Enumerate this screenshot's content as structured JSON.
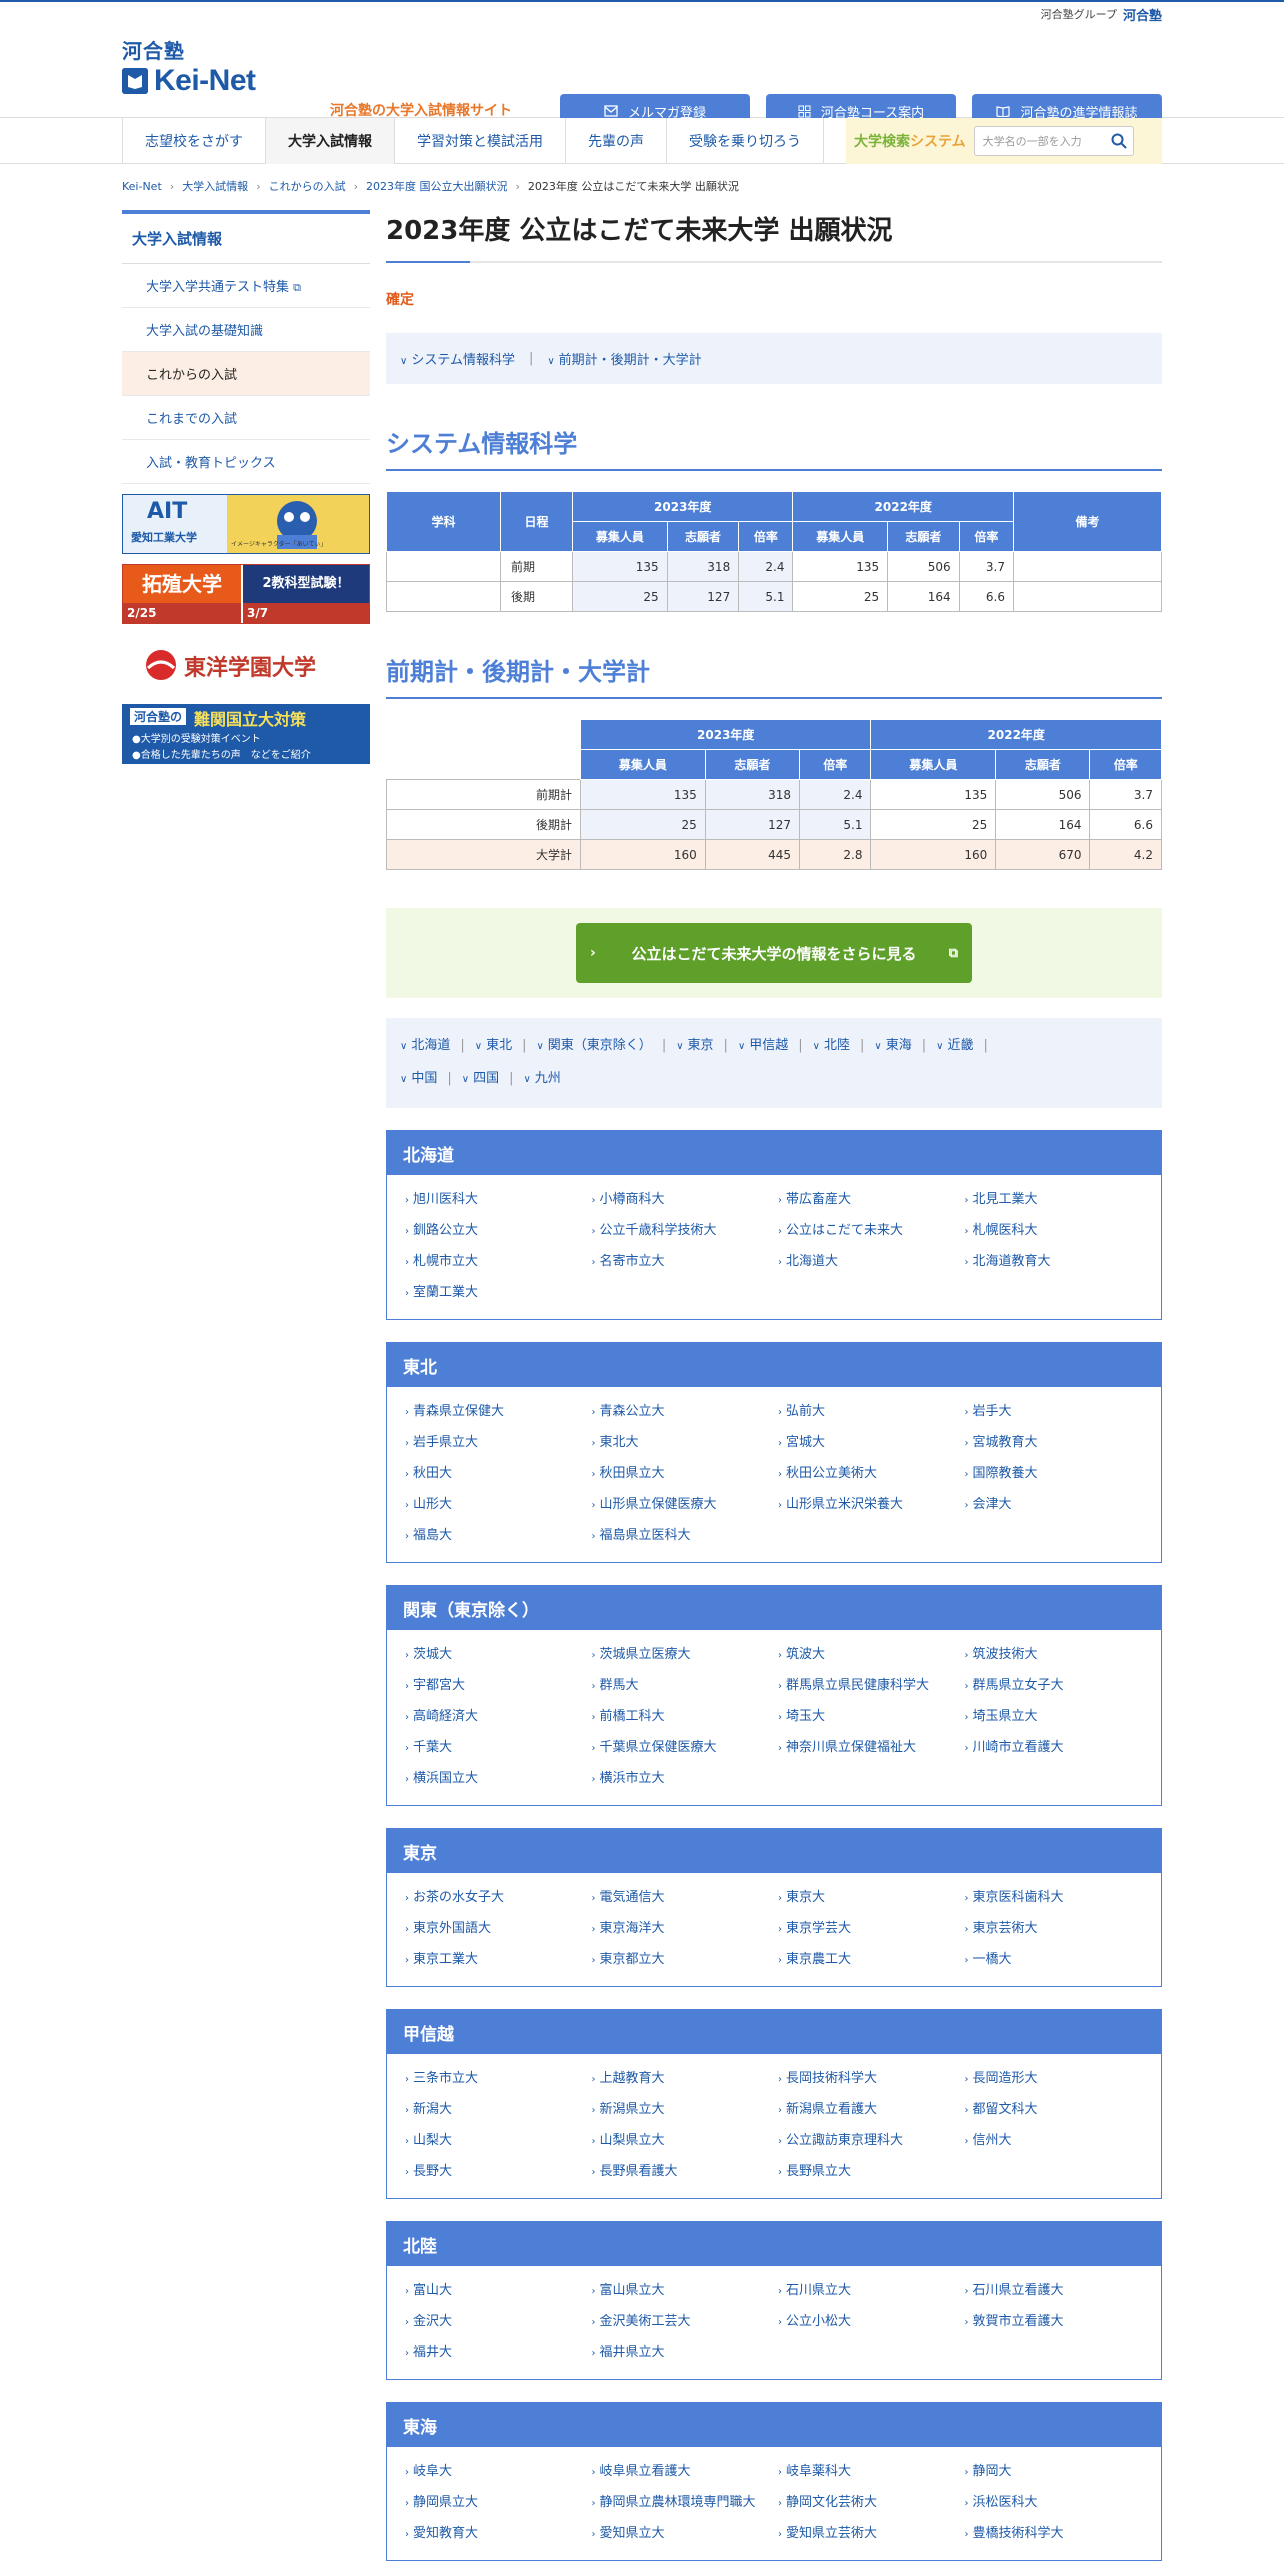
{
  "group": {
    "text": "河合塾グループ",
    "brand": "河合塾"
  },
  "logo": {
    "top": "河合塾",
    "name": "Kei-Net",
    "tagline": "河合塾の大学入試情報サイト"
  },
  "header_buttons": [
    {
      "label": "メルマガ登録",
      "icon": "mail-icon"
    },
    {
      "label": "河合塾コース案内",
      "icon": "grid-icon"
    },
    {
      "label": "河合塾の進学情報誌",
      "icon": "book-icon"
    }
  ],
  "nav": {
    "items": [
      "志望校をさがす",
      "大学入試情報",
      "学習対策と模試活用",
      "先輩の声",
      "受験を乗り切ろう"
    ],
    "search_label_1": "大学検索",
    "search_label_2": "システム",
    "search_placeholder": "大学名の一部を入力"
  },
  "breadcrumb": [
    "Kei-Net",
    "大学入試情報",
    "これからの入試",
    "2023年度 国公立大出願状況",
    "2023年度 公立はこだて未来大学 出願状況"
  ],
  "sidebar": {
    "head": "大学入試情報",
    "items": [
      "大学入学共通テスト特集",
      "大学入試の基礎知識",
      "これからの入試",
      "これまでの入試",
      "入試・教育トピックス"
    ]
  },
  "banners": {
    "b1_main": "AIT",
    "b1_sub": "愛知工業大学",
    "b1_note": "イメージキャラクター「あいてぃ」",
    "b2_main": "拓殖大学",
    "b2_badge": "2教科型試験！",
    "b2_date1": "2/25",
    "b2_date2": "3/7",
    "b3": "東洋学園大学",
    "b4_top": "河合塾の",
    "b4_title": "難関国立大対策",
    "b4_l1": "●大学別の受験対策イベント",
    "b4_l2": "●合格した先輩たちの声　などをご紹介"
  },
  "page": {
    "title": "2023年度 公立はこだて未来大学 出願状況",
    "status": "確定",
    "jump": [
      "システム情報科学",
      "前期計・後期計・大学計"
    ]
  },
  "sec1": {
    "title": "システム情報科学",
    "h_gakka": "学科",
    "h_nittei": "日程",
    "h_2023": "2023年度",
    "h_2022": "2022年度",
    "h_biko": "備考",
    "h_sub": [
      "募集人員",
      "志願者",
      "倍率",
      "募集人員",
      "志願者",
      "倍率"
    ],
    "rows": [
      {
        "gakka": "",
        "nittei": "前期",
        "v": [
          "135",
          "318",
          "2.4",
          "135",
          "506",
          "3.7"
        ],
        "biko": ""
      },
      {
        "gakka": "",
        "nittei": "後期",
        "v": [
          "25",
          "127",
          "5.1",
          "25",
          "164",
          "6.6"
        ],
        "biko": ""
      }
    ]
  },
  "sec2": {
    "title": "前期計・後期計・大学計",
    "h_2023": "2023年度",
    "h_2022": "2022年度",
    "h_sub": [
      "募集人員",
      "志願者",
      "倍率",
      "募集人員",
      "志願者",
      "倍率"
    ],
    "rows": [
      {
        "label": "前期計",
        "v": [
          "135",
          "318",
          "2.4",
          "135",
          "506",
          "3.7"
        ]
      },
      {
        "label": "後期計",
        "v": [
          "25",
          "127",
          "5.1",
          "25",
          "164",
          "6.6"
        ]
      },
      {
        "label": "大学計",
        "v": [
          "160",
          "445",
          "2.8",
          "160",
          "670",
          "4.2"
        ]
      }
    ]
  },
  "more_button": "公立はこだて未来大学の情報をさらに見る",
  "area_jump": [
    "北海道",
    "東北",
    "関東（東京除く）",
    "東京",
    "甲信越",
    "北陸",
    "東海",
    "近畿",
    "中国",
    "四国",
    "九州"
  ],
  "regions": [
    {
      "name": "北海道",
      "unis": [
        "旭川医科大",
        "小樽商科大",
        "帯広畜産大",
        "北見工業大",
        "釧路公立大",
        "公立千歳科学技術大",
        "公立はこだて未来大",
        "札幌医科大",
        "札幌市立大",
        "名寄市立大",
        "北海道大",
        "北海道教育大",
        "室蘭工業大"
      ]
    },
    {
      "name": "東北",
      "unis": [
        "青森県立保健大",
        "青森公立大",
        "弘前大",
        "岩手大",
        "岩手県立大",
        "東北大",
        "宮城大",
        "宮城教育大",
        "秋田大",
        "秋田県立大",
        "秋田公立美術大",
        "国際教養大",
        "山形大",
        "山形県立保健医療大",
        "山形県立米沢栄養大",
        "会津大",
        "福島大",
        "福島県立医科大"
      ]
    },
    {
      "name": "関東（東京除く）",
      "unis": [
        "茨城大",
        "茨城県立医療大",
        "筑波大",
        "筑波技術大",
        "宇都宮大",
        "群馬大",
        "群馬県立県民健康科学大",
        "群馬県立女子大",
        "高崎経済大",
        "前橋工科大",
        "埼玉大",
        "埼玉県立大",
        "千葉大",
        "千葉県立保健医療大",
        "神奈川県立保健福祉大",
        "川崎市立看護大",
        "横浜国立大",
        "横浜市立大"
      ]
    },
    {
      "name": "東京",
      "unis": [
        "お茶の水女子大",
        "電気通信大",
        "東京大",
        "東京医科歯科大",
        "東京外国語大",
        "東京海洋大",
        "東京学芸大",
        "東京芸術大",
        "東京工業大",
        "東京都立大",
        "東京農工大",
        "一橋大"
      ]
    },
    {
      "name": "甲信越",
      "unis": [
        "三条市立大",
        "上越教育大",
        "長岡技術科学大",
        "長岡造形大",
        "新潟大",
        "新潟県立大",
        "新潟県立看護大",
        "都留文科大",
        "山梨大",
        "山梨県立大",
        "公立諏訪東京理科大",
        "信州大",
        "長野大",
        "長野県看護大",
        "長野県立大"
      ]
    },
    {
      "name": "北陸",
      "unis": [
        "富山大",
        "富山県立大",
        "石川県立大",
        "石川県立看護大",
        "金沢大",
        "金沢美術工芸大",
        "公立小松大",
        "敦賀市立看護大",
        "福井大",
        "福井県立大"
      ]
    },
    {
      "name": "東海",
      "unis": [
        "岐阜大",
        "岐阜県立看護大",
        "岐阜薬科大",
        "静岡大",
        "静岡県立大",
        "静岡県立農林環境専門職大",
        "静岡文化芸術大",
        "浜松医科大",
        "愛知教育大",
        "愛知県立大",
        "愛知県立芸術大",
        "豊橋技術科学大"
      ]
    }
  ]
}
